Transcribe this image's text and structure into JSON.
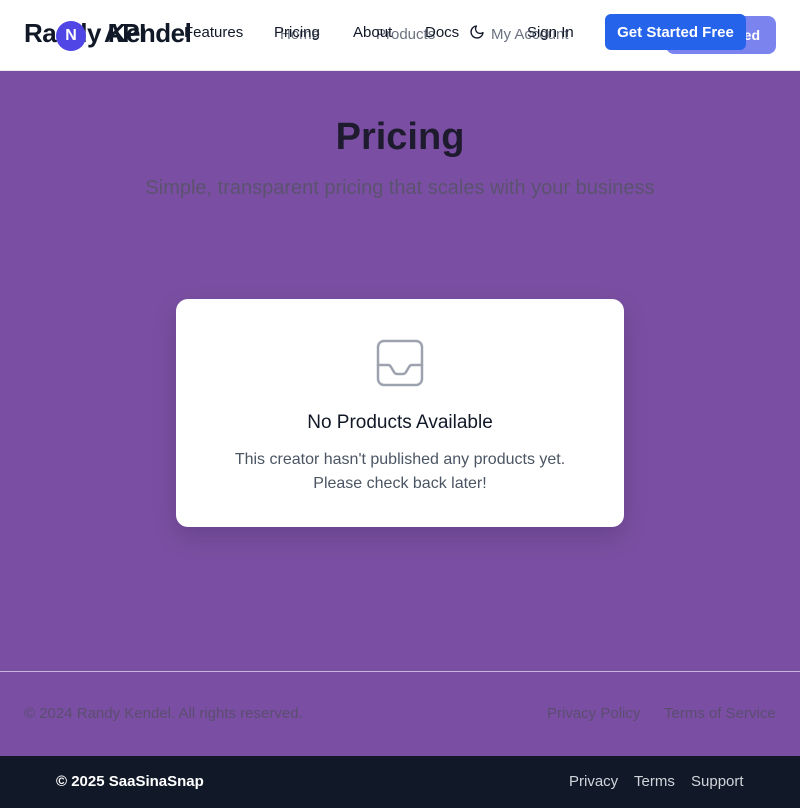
{
  "header": {
    "brand": "Randy Kendel",
    "brand_overlay": "API",
    "logo_letter": "N",
    "nav_under": [
      "Home",
      "Products",
      "My Account"
    ],
    "nav_top": [
      "Features",
      "Pricing",
      "About",
      "Docs",
      "Sign In"
    ],
    "theme_icon": "moon-icon",
    "under_button_label": "Get Started",
    "cta_label": "Get Started Free"
  },
  "hero": {
    "title": "Pricing",
    "subtitle": "Simple, transparent pricing that scales with your business"
  },
  "empty_state": {
    "icon": "inbox-icon",
    "title": "No Products Available",
    "line1": "This creator hasn't published any products yet.",
    "line2": "Please check back later!"
  },
  "creator_footer": {
    "copyright": "© 2024 Randy Kendel. All rights reserved.",
    "links": [
      "Privacy Policy",
      "Terms of Service"
    ]
  },
  "platform_footer": {
    "copyright": "© 2025 SaaSinaSnap",
    "links": [
      "Privacy",
      "Terms",
      "Support"
    ]
  },
  "colors": {
    "background": "#7a4fa3",
    "accent": "#2563eb",
    "footer_bg": "#111827"
  }
}
